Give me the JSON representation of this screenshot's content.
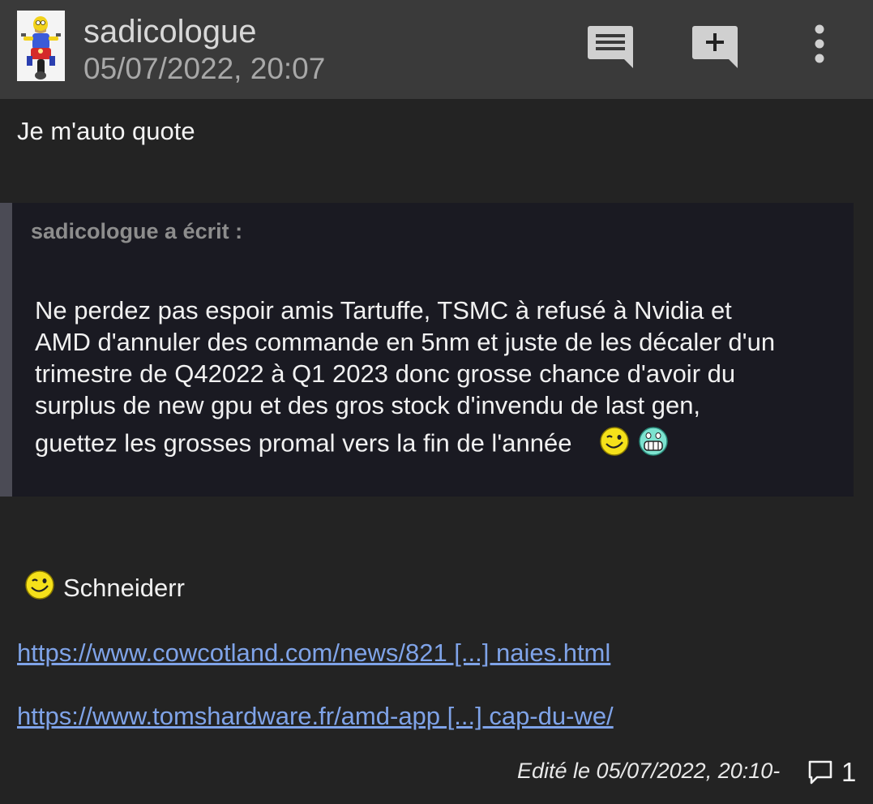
{
  "post": {
    "author": "sadicologue",
    "date": "05/07/2022, 20:07",
    "intro": "Je m'auto quote",
    "quote": {
      "author_line": "sadicologue a écrit :",
      "lines": [
        "Ne perdez pas espoir amis Tartuffe, TSMC à refusé à Nvidia et",
        "AMD d'annuler des commande  en 5nm et juste de les décaler d'un",
        "trimestre de Q42022 à Q1 2023 donc grosse chance d'avoir du",
        "surplus de new gpu et des gros stock d'invendu de last gen,",
        "guettez les grosses promal vers la fin de l'année"
      ],
      "smileys": [
        "wink-smiley-icon",
        "grin-smiley-icon"
      ]
    },
    "signature": "Schneiderr",
    "links": [
      "https://www.cowcotland.com/news/821 [...] naies.html",
      "https://www.tomshardware.fr/amd-app [...] cap-du-we/"
    ],
    "edited": "Edité le 05/07/2022, 20:10-",
    "comment_count": "1"
  },
  "colors": {
    "header_bg": "#3a3a3a",
    "page_bg": "#232323",
    "quote_bg": "#1a1a22",
    "link": "#7fa3e8"
  }
}
